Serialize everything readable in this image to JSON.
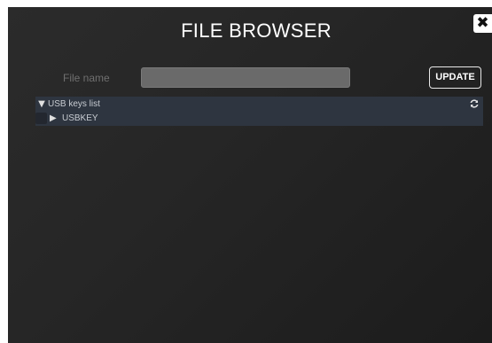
{
  "dialog": {
    "title": "FILE BROWSER",
    "close_icon": "close-icon"
  },
  "form": {
    "filename_label": "File name",
    "filename_value": "",
    "filename_placeholder": "",
    "update_label": "UPDATE"
  },
  "tree": {
    "header_arrow": "▼",
    "header_label": "USB keys list",
    "refresh_icon": "refresh-icon",
    "items": [
      {
        "arrow": "▶",
        "label": "USBKEY",
        "checked": false
      }
    ]
  },
  "colors": {
    "dialog_background": "#262626",
    "tree_background": "#2e3540",
    "input_background": "#6a6a6a"
  }
}
